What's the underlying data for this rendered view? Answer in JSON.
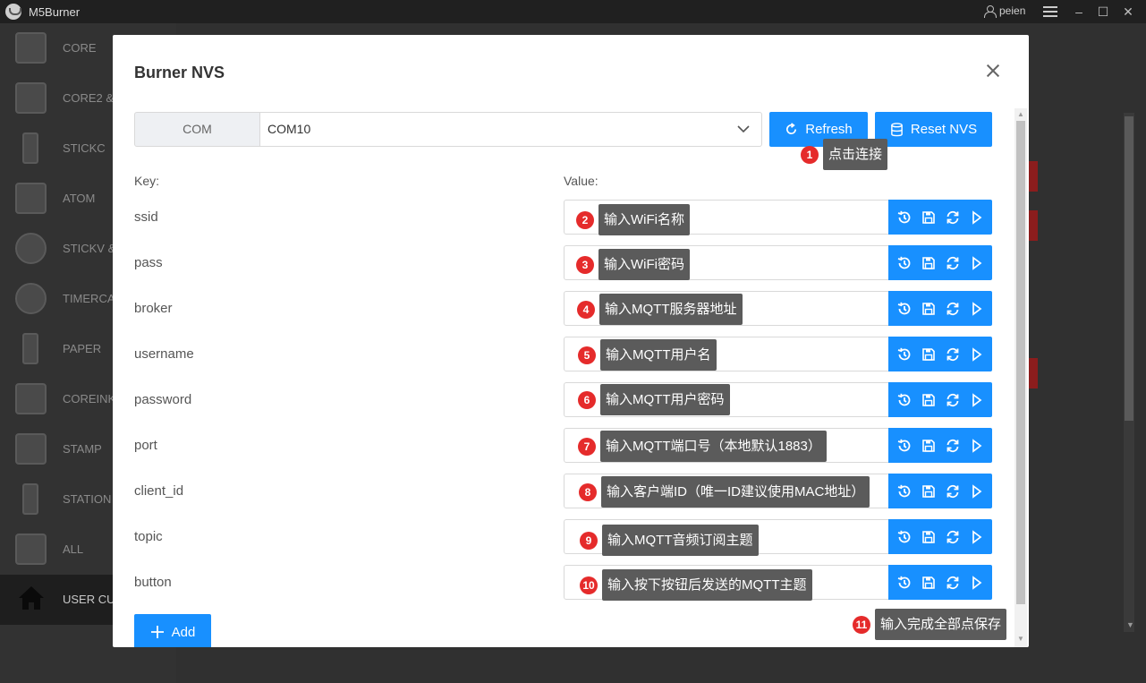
{
  "app": {
    "title": "M5Burner",
    "user": "peien"
  },
  "sidebar": {
    "items": [
      {
        "label": "CORE"
      },
      {
        "label": "CORE2 &"
      },
      {
        "label": "STICKC"
      },
      {
        "label": "ATOM"
      },
      {
        "label": "STICKV &"
      },
      {
        "label": "TIMERCA"
      },
      {
        "label": "PAPER"
      },
      {
        "label": "COREINK"
      },
      {
        "label": "STAMP"
      },
      {
        "label": "STATION"
      },
      {
        "label": "ALL"
      },
      {
        "label": "USER CU"
      }
    ]
  },
  "modal": {
    "title": "Burner NVS",
    "com_label": "COM",
    "com_value": "COM10",
    "refresh_label": "Refresh",
    "reset_label": "Reset NVS",
    "key_header": "Key:",
    "value_header": "Value:",
    "add_label": "Add",
    "rows": [
      {
        "key": "ssid"
      },
      {
        "key": "pass"
      },
      {
        "key": "broker"
      },
      {
        "key": "username"
      },
      {
        "key": "password"
      },
      {
        "key": "port"
      },
      {
        "key": "client_id"
      },
      {
        "key": "topic"
      },
      {
        "key": "button"
      }
    ]
  },
  "annotations": [
    {
      "num": "1",
      "text": "点击连接"
    },
    {
      "num": "2",
      "text": "输入WiFi名称"
    },
    {
      "num": "3",
      "text": "输入WiFi密码"
    },
    {
      "num": "4",
      "text": "输入MQTT服务器地址"
    },
    {
      "num": "5",
      "text": "输入MQTT用户名"
    },
    {
      "num": "6",
      "text": "输入MQTT用户密码"
    },
    {
      "num": "7",
      "text": "输入MQTT端口号（本地默认1883）"
    },
    {
      "num": "8",
      "text": "输入客户端ID（唯一ID建议使用MAC地址）"
    },
    {
      "num": "9",
      "text": "输入MQTT音频订阅主题"
    },
    {
      "num": "10",
      "text": "输入按下按钮后发送的MQTT主题"
    },
    {
      "num": "11",
      "text": "输入完成全部点保存"
    }
  ],
  "colors": {
    "primary": "#1890ff",
    "annotation_badge": "#e52b2b",
    "annotation_bg": "#5b5b5b"
  }
}
